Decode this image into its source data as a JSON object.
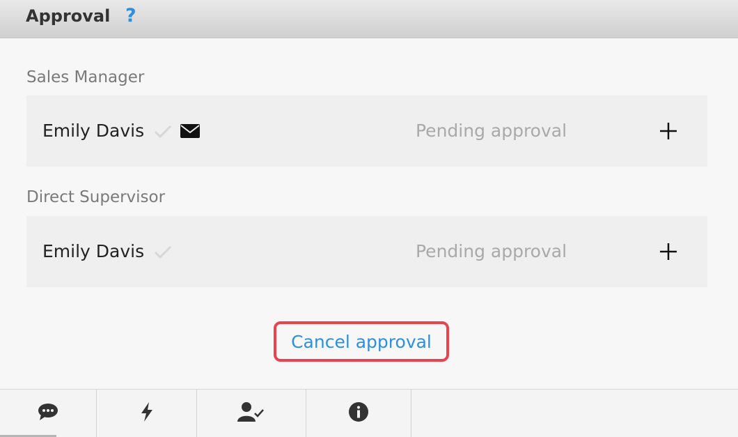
{
  "header": {
    "title": "Approval",
    "help_symbol": "?"
  },
  "approval_groups": [
    {
      "label": "Sales Manager",
      "approver": "Emily Davis",
      "status": "Pending approval",
      "icons": [
        "check-icon",
        "mail-icon",
        "plus-icon"
      ]
    },
    {
      "label": "Direct Supervisor",
      "approver": "Emily Davis",
      "status": "Pending approval",
      "icons": [
        "check-icon",
        "plus-icon"
      ]
    }
  ],
  "cancel_button": {
    "label": "Cancel approval"
  },
  "toolbar": {
    "tabs": [
      {
        "name": "comments",
        "icon": "chat-bubble-icon"
      },
      {
        "name": "actions",
        "icon": "lightning-icon"
      },
      {
        "name": "approvals",
        "icon": "user-check-icon"
      },
      {
        "name": "info",
        "icon": "info-icon"
      }
    ],
    "active_tab": "comments"
  },
  "colors": {
    "accent": "#2d8fe0",
    "highlight_border": "#e8434f",
    "pending_text": "#a9a9a9",
    "header_background": "#d9d9d9"
  }
}
